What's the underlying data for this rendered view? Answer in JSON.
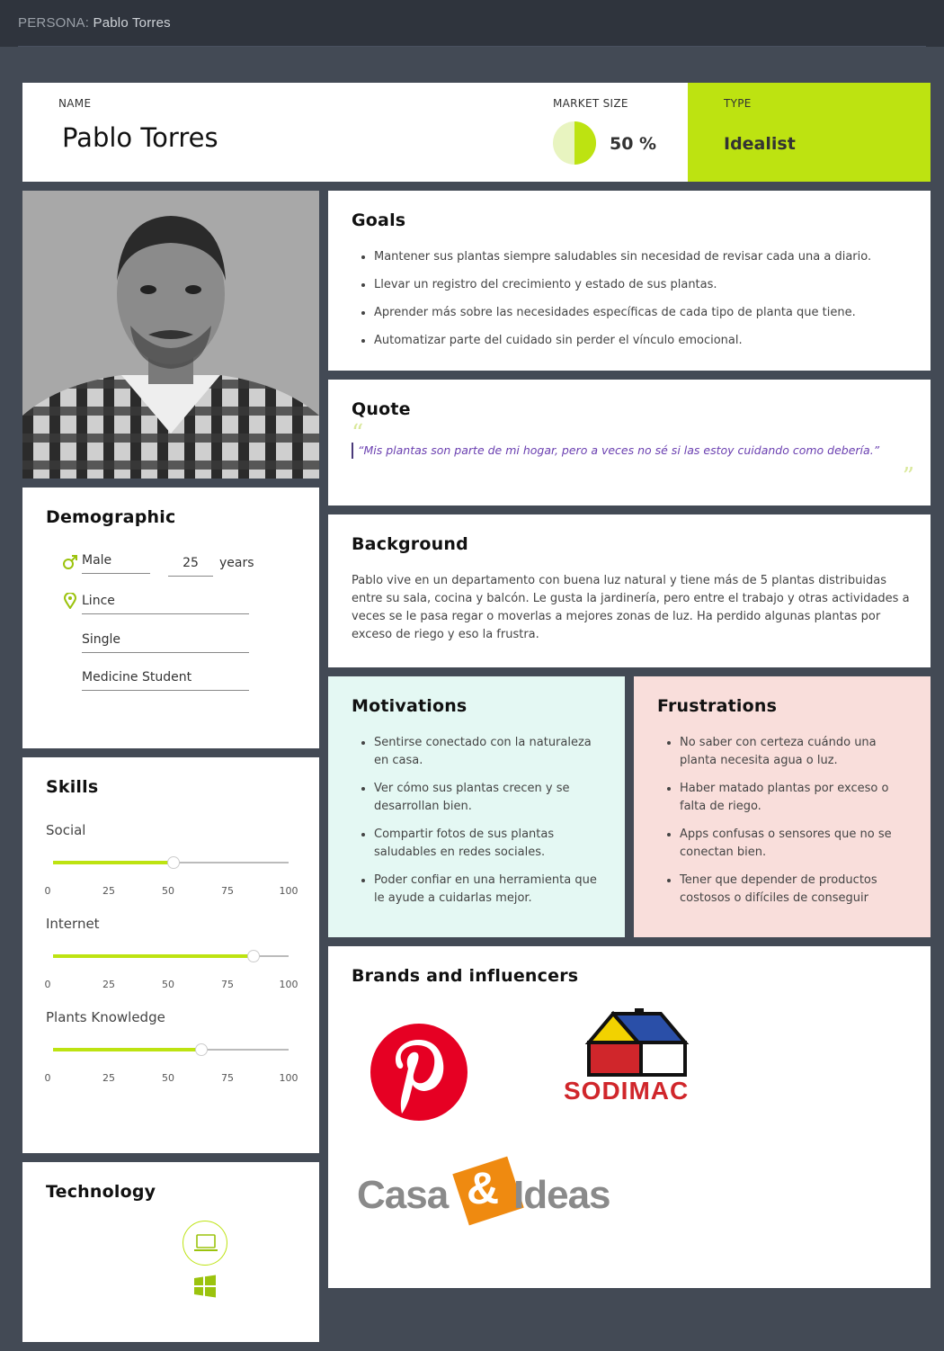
{
  "topbar": {
    "label": "PERSONA:",
    "name": "Pablo Torres"
  },
  "header": {
    "name_label": "NAME",
    "name": "Pablo Torres",
    "market_label": "MARKET SIZE",
    "market_value": "50 %",
    "market_fraction": 0.5,
    "type_label": "TYPE",
    "type_value": "Idealist"
  },
  "goals": {
    "title": "Goals",
    "items": [
      "Mantener sus plantas siempre saludables sin necesidad de revisar cada una a diario.",
      "Llevar un registro del crecimiento y estado de sus plantas.",
      "Aprender más sobre las necesidades específicas de cada tipo de planta que tiene.",
      "Automatizar parte del cuidado sin perder el vínculo emocional."
    ]
  },
  "quote": {
    "title": "Quote",
    "text": "“Mis plantas son parte de mi hogar, pero a veces no sé si las estoy cuidando como debería.”"
  },
  "background": {
    "title": "Background",
    "text": "Pablo  vive en un departamento con buena luz natural y tiene más de 5 plantas distribuidas entre su sala, cocina y balcón. Le gusta la jardinería, pero entre el trabajo y otras actividades a veces se le pasa regar o moverlas a mejores zonas de luz. Ha perdido algunas plantas por exceso de riego y eso la frustra."
  },
  "motivations": {
    "title": "Motivations",
    "items": [
      "Sentirse conectado con la naturaleza en casa.",
      "Ver cómo sus plantas crecen y se desarrollan bien.",
      "Compartir fotos de sus plantas saludables en redes sociales.",
      "Poder confiar en una herramienta que le ayude a cuidarlas mejor."
    ]
  },
  "frustrations": {
    "title": "Frustrations",
    "items": [
      "No saber con certeza cuándo una planta necesita agua o luz.",
      "Haber matado plantas por exceso o falta de riego.",
      "Apps confusas o sensores que no se conectan bien.",
      "Tener que depender de productos costosos o difíciles de conseguir"
    ]
  },
  "demographic": {
    "title": "Demographic",
    "gender": "Male",
    "age": "25",
    "age_unit": "years",
    "location": "Lince",
    "status": "Single",
    "occupation": "Medicine Student",
    "gender_icon": "male-icon",
    "location_icon": "location-pin-icon"
  },
  "skills": {
    "title": "Skills",
    "ticks": [
      "0",
      "25",
      "50",
      "75",
      "100"
    ],
    "items": [
      {
        "label": "Social",
        "value": 51
      },
      {
        "label": "Internet",
        "value": 85
      },
      {
        "label": "Plants Knowledge",
        "value": 63
      }
    ]
  },
  "technology": {
    "title": "Technology",
    "icons": [
      "laptop-icon",
      "windows-icon"
    ]
  },
  "brands": {
    "title": "Brands and influencers",
    "logos": [
      "pinterest-logo",
      "sodimac-logo",
      "casa-ideas-logo"
    ],
    "sodimac_text": "SODIMAC",
    "casa_left": "Casa",
    "casa_amp": "&",
    "casa_right": "Ideas"
  },
  "colors": {
    "accent": "#bde311",
    "motivations_bg": "#e4f8f3",
    "frustrations_bg": "#f9dedb",
    "quote_text": "#6a3fb0"
  }
}
